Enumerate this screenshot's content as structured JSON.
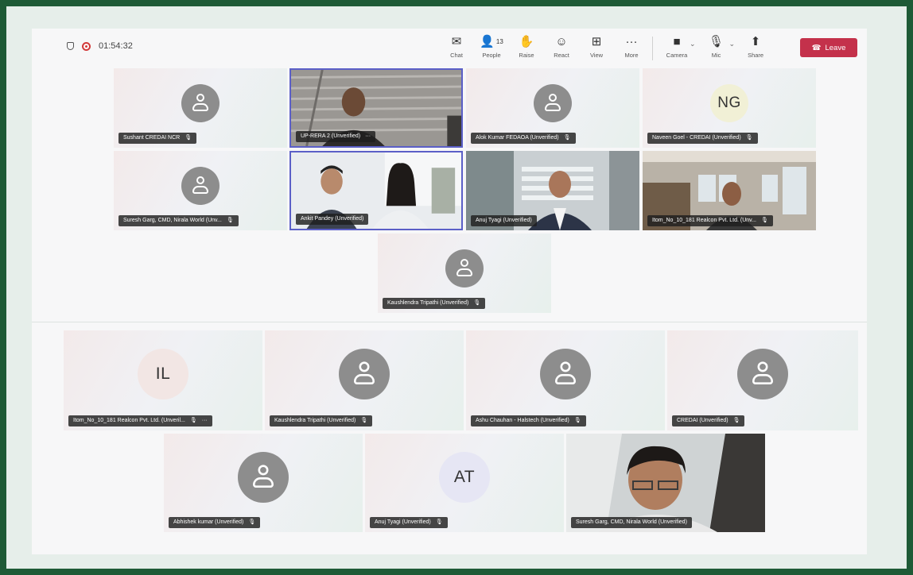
{
  "meeting": {
    "timer": "01:54:32"
  },
  "toolbar": [
    {
      "label": "Chat",
      "icon": "chat-icon",
      "glyph": "✉"
    },
    {
      "label": "People",
      "icon": "people-icon",
      "glyph": "👤",
      "count": "13"
    },
    {
      "label": "Raise",
      "icon": "raise-hand-icon",
      "glyph": "✋"
    },
    {
      "label": "React",
      "icon": "react-icon",
      "glyph": "☺"
    },
    {
      "label": "View",
      "icon": "view-icon",
      "glyph": "⊞"
    },
    {
      "label": "More",
      "icon": "more-icon",
      "glyph": "···"
    }
  ],
  "devices": [
    {
      "label": "Camera",
      "icon": "camera-off-icon",
      "glyph": "■"
    },
    {
      "label": "Mic",
      "icon": "mic-off-icon",
      "glyph": "🎙"
    },
    {
      "label": "Share",
      "icon": "share-icon",
      "glyph": "⬆"
    }
  ],
  "leave": {
    "label": "Leave"
  },
  "upper_tiles": [
    {
      "name": "Sushant CREDAI NCR",
      "kind": "avatar",
      "muted": true
    },
    {
      "name": "UP-RERA 2 (Unverified)",
      "kind": "video",
      "more": "···"
    },
    {
      "name": "Alok Kumar FEDAOA (Unverified)",
      "kind": "avatar",
      "muted": true
    },
    {
      "name": "Naveen Goel - CREDAI (Unverified)",
      "kind": "initials",
      "initials": "NG",
      "muted": true
    },
    {
      "name": "Suresh Garg, CMD, Nirala World (Unv...",
      "kind": "avatar",
      "muted": true
    },
    {
      "name": "Ankit Pandey (Unverified)",
      "kind": "video"
    },
    {
      "name": "Anuj Tyagi (Unverified)",
      "kind": "video"
    },
    {
      "name": "Itom_No_10_181 Realcon Pvt. Ltd. (Unv...",
      "kind": "video",
      "muted": true
    },
    {
      "name": "Kaushlendra Tripathi (Unverified)",
      "kind": "avatar",
      "muted": true
    }
  ],
  "lower_tiles": [
    {
      "name": "Itom_No_10_181 Realcon Pvt. Ltd. (Unveril...",
      "kind": "initials",
      "initials": "IL",
      "muted": true,
      "more": "···"
    },
    {
      "name": "Kaushlendra Tripathi (Unverified)",
      "kind": "avatar",
      "muted": true
    },
    {
      "name": "Ashu Chauhan - Halstech (Unverified)",
      "kind": "avatar",
      "muted": true
    },
    {
      "name": "CREDAI (Unverified)",
      "kind": "avatar",
      "muted": true
    },
    {
      "name": "Abhishek kumar (Unverified)",
      "kind": "avatar",
      "muted": true
    },
    {
      "name": "Anuj Tyagi (Unverified)",
      "kind": "initials",
      "initials": "AT",
      "muted": true
    },
    {
      "name": "Suresh Garg, CMD, Nirala World (Unverified)",
      "kind": "video"
    }
  ],
  "colors": {
    "frame": "#1e5a36",
    "leave": "#c4314b",
    "selected": "#5b5fc7"
  }
}
